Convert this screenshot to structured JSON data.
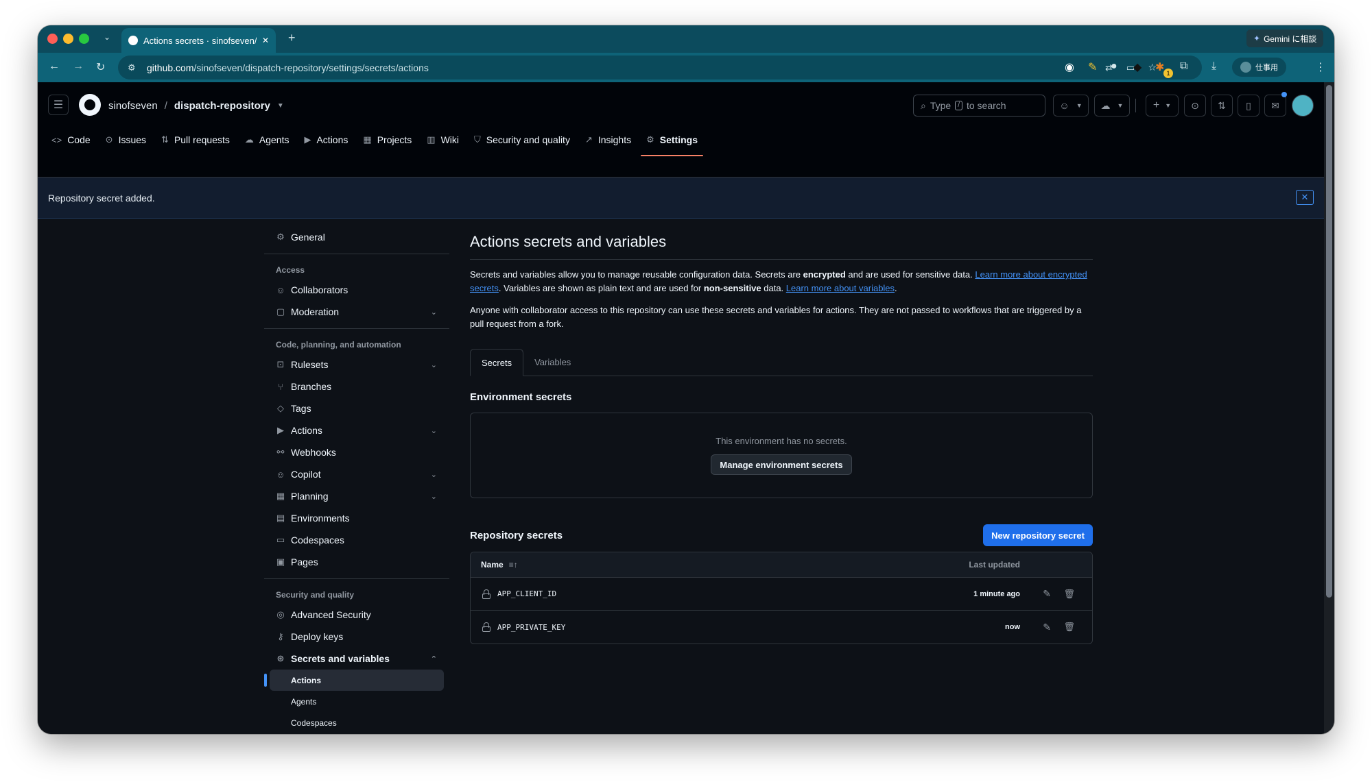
{
  "browser": {
    "tab_title": "Actions secrets · sinofseven/d",
    "url_host": "github.com",
    "url_path": "/sinofseven/dispatch-repository/settings/secrets/actions",
    "gemini_label": "Gemini に相談",
    "profile_label": "仕事用",
    "extension_badge": "1"
  },
  "header": {
    "owner": "sinofseven",
    "separator": "/",
    "repo": "dispatch-repository",
    "search_prefix": "Type",
    "search_key": "/",
    "search_suffix": "to search"
  },
  "repo_nav": {
    "code": "Code",
    "issues": "Issues",
    "pull_requests": "Pull requests",
    "agents": "Agents",
    "actions": "Actions",
    "projects": "Projects",
    "wiki": "Wiki",
    "security": "Security and quality",
    "insights": "Insights",
    "settings": "Settings"
  },
  "flash": {
    "message": "Repository secret added.",
    "close_glyph": "✕"
  },
  "sidebar": {
    "general": "General",
    "access_heading": "Access",
    "collaborators": "Collaborators",
    "moderation": "Moderation",
    "code_heading": "Code, planning, and automation",
    "rulesets": "Rulesets",
    "branches": "Branches",
    "tags": "Tags",
    "actions": "Actions",
    "webhooks": "Webhooks",
    "copilot": "Copilot",
    "planning": "Planning",
    "environments": "Environments",
    "codespaces": "Codespaces",
    "pages": "Pages",
    "security_heading": "Security and quality",
    "advanced_security": "Advanced Security",
    "deploy_keys": "Deploy keys",
    "secrets_and_variables": "Secrets and variables",
    "sub_actions": "Actions",
    "sub_agents": "Agents",
    "sub_codespaces": "Codespaces"
  },
  "main": {
    "title": "Actions secrets and variables",
    "desc1_a": "Secrets and variables allow you to manage reusable configuration data. Secrets are ",
    "desc1_b": "encrypted",
    "desc1_c": " and are used for sensitive data. ",
    "desc1_link1": "Learn more about encrypted secrets",
    "desc1_d": ". Variables are shown as plain text and are used for ",
    "desc1_e": "non-sensitive",
    "desc1_f": " data. ",
    "desc1_link2": "Learn more about variables",
    "desc1_g": ".",
    "desc2": "Anyone with collaborator access to this repository can use these secrets and variables for actions. They are not passed to workflows that are triggered by a pull request from a fork.",
    "tab_secrets": "Secrets",
    "tab_variables": "Variables",
    "env_heading": "Environment secrets",
    "env_empty": "This environment has no secrets.",
    "env_manage_button": "Manage environment secrets",
    "repo_heading": "Repository secrets",
    "new_secret_button": "New repository secret",
    "col_name": "Name",
    "col_updated": "Last updated",
    "secrets": [
      {
        "name": "APP_CLIENT_ID",
        "updated": "1 minute ago"
      },
      {
        "name": "APP_PRIVATE_KEY",
        "updated": "now"
      }
    ]
  }
}
